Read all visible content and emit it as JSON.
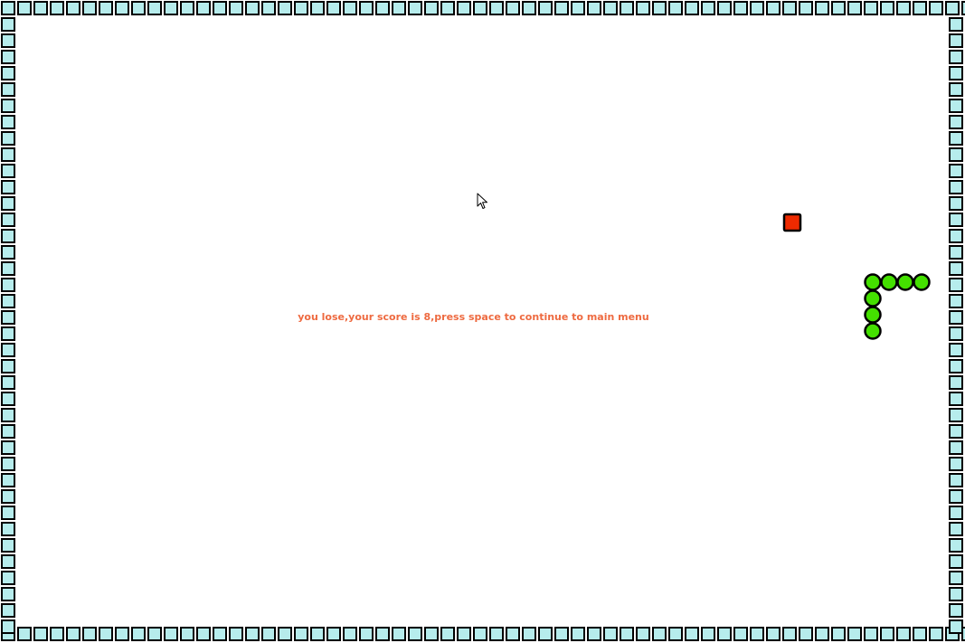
{
  "game": {
    "message": "you lose,your score is 8,press space to continue to main menu",
    "colors": {
      "background": "#ffffff",
      "wall": "#b6ecec",
      "outline": "#000000",
      "snake": "#44e000",
      "food": "#ee2a00",
      "message": "#ee6a40"
    },
    "snake": {
      "segments": [
        [
          56,
          17
        ],
        [
          55,
          17
        ],
        [
          54,
          17
        ],
        [
          53,
          17
        ],
        [
          53,
          18
        ],
        [
          53,
          19
        ],
        [
          53,
          20
        ]
      ]
    },
    "food": {
      "cell": [
        48,
        13
      ]
    }
  },
  "cursor": {
    "icon": "mouse-pointer-icon"
  }
}
